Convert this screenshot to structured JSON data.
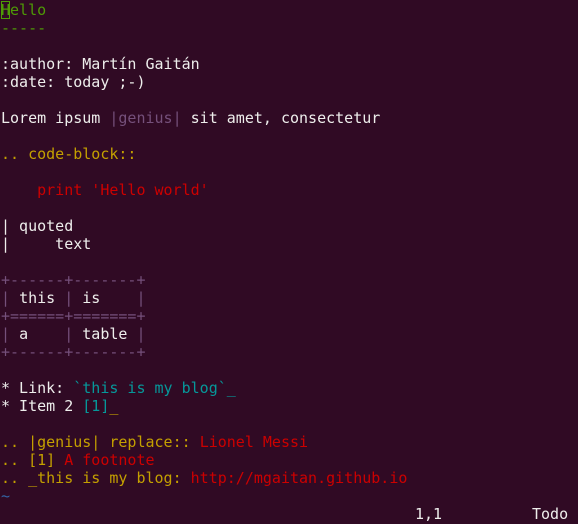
{
  "colors": {
    "background": "#300a24",
    "foreground": "#eeeeec",
    "heading": "#4e9a06",
    "directive": "#c4a000",
    "string": "#cc0000",
    "link": "#06989a",
    "substitution": "#75507b"
  },
  "editor": {
    "title_cursor_char": "H",
    "title_rest": "ello",
    "underline": "-----",
    "author_field": ":author: Martín Gaitán",
    "date_field": ":date: today ;-)",
    "lorem_pre": "Lorem ipsum ",
    "lorem_sub": "|genius|",
    "lorem_post": " sit amet, consectetur",
    "code_block": ".. code-block::",
    "code_line": "    print 'Hello world'",
    "quote_bar_1": "|",
    "quote_text_1": " quoted",
    "quote_bar_2": "|",
    "quote_text_2": "     text",
    "table": {
      "border_top": "+------+-------+",
      "row1_cells": [
        "this",
        "is"
      ],
      "header_sep": "+======+=======+",
      "row2_cells": [
        "a",
        "table"
      ],
      "border_bottom": "+------+-------+"
    },
    "link_item_pre": "* Link: ",
    "link_item_ref": "`this is my blog`_",
    "item2_pre": "* Item 2 ",
    "item2_ref": "[1]",
    "item2_post": "_",
    "sub_def_pre": ".. |genius| replace:: ",
    "sub_def_value": "Lionel Messi",
    "footnote_pre": ".. [1] ",
    "footnote_value": "A footnote",
    "target_pre": ".. _this is my blog: ",
    "target_value": "http://mgaitan.github.io",
    "empty_marker": "~"
  },
  "statusbar": {
    "position": "1,1",
    "scroll": "Todo"
  }
}
